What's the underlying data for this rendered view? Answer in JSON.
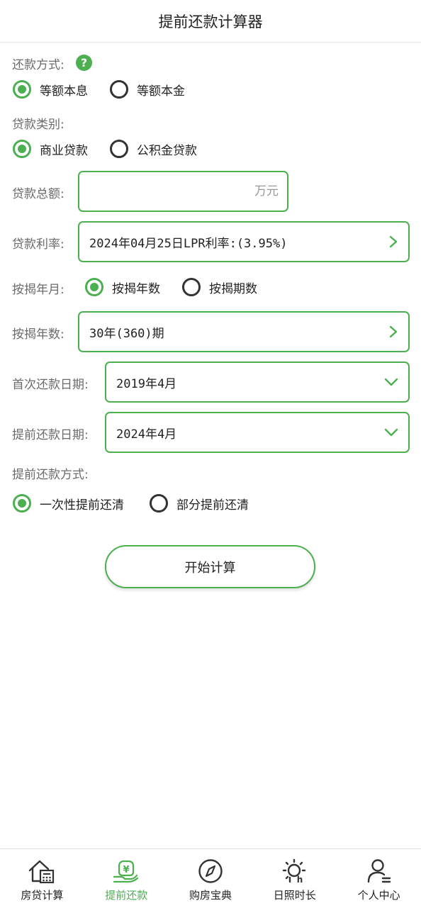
{
  "header": {
    "title": "提前还款计算器"
  },
  "repay_method": {
    "label": "还款方式:",
    "help_icon": "?",
    "options": [
      "等额本息",
      "等额本金"
    ],
    "selected": 0
  },
  "loan_type": {
    "label": "贷款类别:",
    "options": [
      "商业贷款",
      "公积金贷款"
    ],
    "selected": 0
  },
  "loan_amount": {
    "label": "贷款总额:",
    "placeholder": "万元",
    "value": ""
  },
  "loan_rate": {
    "label": "贷款利率:",
    "value": "2024年04月25日LPR利率:(3.95%)"
  },
  "mortgage_mode": {
    "label": "按揭年月:",
    "options": [
      "按揭年数",
      "按揭期数"
    ],
    "selected": 0
  },
  "mortgage_years": {
    "label": "按揭年数:",
    "value": "30年(360)期"
  },
  "first_repay_date": {
    "label": "首次还款日期:",
    "value": "2019年4月"
  },
  "prepay_date": {
    "label": "提前还款日期:",
    "value": "2024年4月"
  },
  "prepay_method": {
    "label": "提前还款方式:",
    "options": [
      "一次性提前还清",
      "部分提前还清"
    ],
    "selected": 0
  },
  "actions": {
    "start_label": "开始计算"
  },
  "tabbar": {
    "items": [
      {
        "label": "房贷计算",
        "icon": "house-calculator-icon"
      },
      {
        "label": "提前还款",
        "icon": "yuan-hand-icon"
      },
      {
        "label": "购房宝典",
        "icon": "compass-icon"
      },
      {
        "label": "日照时长",
        "icon": "sun-hours-icon"
      },
      {
        "label": "个人中心",
        "icon": "user-icon"
      }
    ],
    "active_index": 1
  },
  "colors": {
    "accent": "#4CAF50",
    "text": "#222222",
    "label": "#6b6b6b"
  }
}
